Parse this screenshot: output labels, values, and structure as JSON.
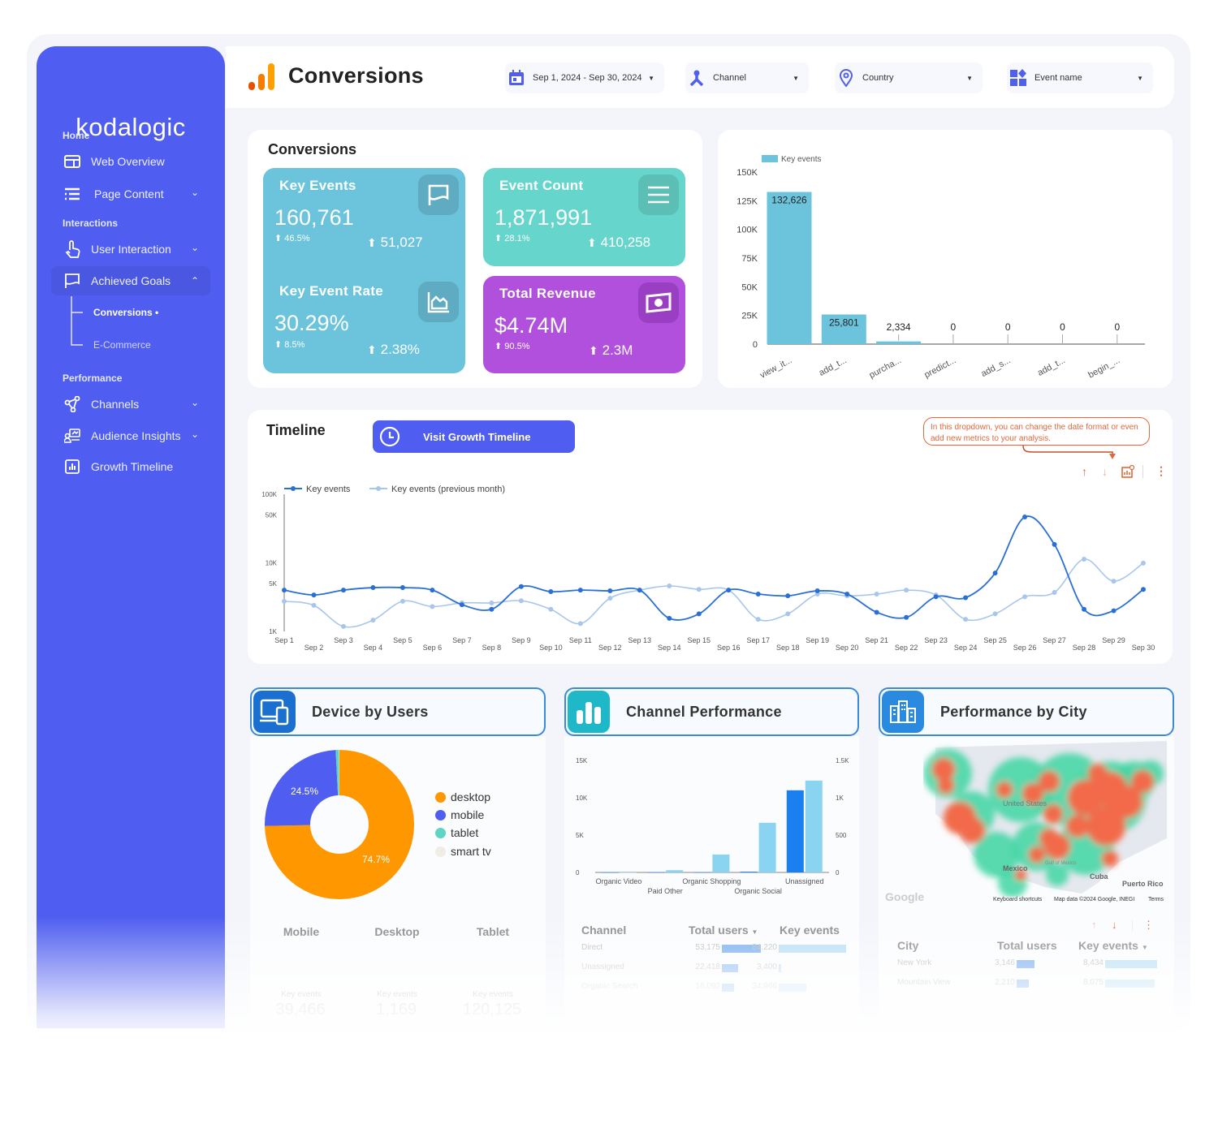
{
  "sidebar": {
    "logo": "kodalogic",
    "sections": [
      {
        "label": "Home"
      },
      {
        "label": "Interactions"
      },
      {
        "label": "Performance"
      }
    ],
    "items": [
      {
        "label": "Web Overview",
        "icon": "layout-icon"
      },
      {
        "label": "Page Content",
        "icon": "list-icon",
        "chevron": "down"
      },
      {
        "label": "User Interaction",
        "icon": "hand-pointer-icon",
        "chevron": "down"
      },
      {
        "label": "Achieved Goals",
        "icon": "flag-icon",
        "chevron": "up",
        "active": true
      },
      {
        "label": "Channels",
        "icon": "share-nodes-icon",
        "chevron": "down"
      },
      {
        "label": "Audience Insights",
        "icon": "presentation-icon",
        "chevron": "down"
      },
      {
        "label": "Growth Timeline",
        "icon": "bar-chart-icon"
      }
    ],
    "subitems": [
      {
        "label": "Conversions •",
        "active": true
      },
      {
        "label": "E-Commerce"
      }
    ]
  },
  "header": {
    "title": "Conversions",
    "filters": [
      {
        "label": "Sep 1, 2024 - Sep 30, 2024",
        "icon": "calendar-icon"
      },
      {
        "label": "Channel",
        "icon": "channel-icon"
      },
      {
        "label": "Country",
        "icon": "location-pin-icon"
      },
      {
        "label": "Event name",
        "icon": "shapes-icon"
      }
    ]
  },
  "conversions": {
    "title": "Conversions",
    "kpis": [
      {
        "title": "Key Events",
        "value": "160,761",
        "pct": "46.5%",
        "delta": "51,027",
        "color": "#6bc4dc",
        "icon": "flag-icon"
      },
      {
        "title": "Event Count",
        "value": "1,871,991",
        "pct": "28.1%",
        "delta": "410,258",
        "color": "#66d6cc",
        "icon": "menu-icon"
      },
      {
        "title": "Key Event Rate",
        "value": "30.29%",
        "pct": "8.5%",
        "delta": "2.38%",
        "color": "#6bc4dc",
        "icon": "area-chart-icon"
      },
      {
        "title": "Total Revenue",
        "value": "$4.74M",
        "pct": "90.5%",
        "delta": "2.3M",
        "color": "#b150dc",
        "icon": "money-icon"
      }
    ]
  },
  "timeline": {
    "title": "Timeline",
    "button": "Visit Growth Timeline",
    "tooltip": "In this dropdown, you can change the date format or even add new metrics to your analysis."
  },
  "device": {
    "title": "Device by Users",
    "columns": [
      "Mobile",
      "Desktop",
      "Tablet"
    ],
    "metric_label": "Key events",
    "metric_values": [
      "39,466",
      "1,169",
      "120,125"
    ]
  },
  "channel": {
    "title": "Channel Performance",
    "headers": [
      "Channel",
      "Total users",
      "Key events"
    ],
    "rows": [
      {
        "name": "Direct",
        "users": "53,175",
        "users_n": 53175,
        "events": "84,220",
        "events_n": 84220
      },
      {
        "name": "Unassigned",
        "users": "22,418",
        "users_n": 22418,
        "events": "3,400",
        "events_n": 3400
      },
      {
        "name": "Organic Search",
        "users": "16,092",
        "users_n": 16092,
        "events": "34,966",
        "events_n": 34966
      }
    ]
  },
  "city": {
    "title": "Performance by City",
    "headers": [
      "City",
      "Total users",
      "Key events"
    ],
    "rows": [
      {
        "name": "New York",
        "users": "3,146",
        "users_n": 3146,
        "events": "8,434",
        "events_n": 8434
      },
      {
        "name": "Mountain View",
        "users": "2,210",
        "users_n": 2210,
        "events": "8,075",
        "events_n": 8075
      }
    ],
    "map": {
      "labels": [
        "United States",
        "Mexico",
        "Cuba",
        "Puerto Rico",
        "Gulf of Mexico"
      ],
      "logo": "Google",
      "shortcuts": "Keyboard shortcuts",
      "attribution": "Map data ©2024 Google, INEGI",
      "terms": "Terms"
    }
  },
  "colors": {
    "sidebar": "#4f5ef0",
    "accent_orange": "#e0683c",
    "line_dark": "#2a6fd6",
    "line_light": "#a8c6ec"
  },
  "chart_data": [
    {
      "type": "bar",
      "legend": "Key events",
      "categories": [
        "view_it...",
        "add_t...",
        "purcha...",
        "predict...",
        "add_s...",
        "add_t...",
        "begin_..."
      ],
      "values": [
        132626,
        25801,
        2334,
        0,
        0,
        0,
        0
      ],
      "data_labels": [
        "132,626",
        "25,801",
        "2,334",
        "0",
        "0",
        "0",
        "0"
      ],
      "ylim": [
        0,
        150000
      ],
      "yticks": [
        "0",
        "25K",
        "50K",
        "75K",
        "100K",
        "125K",
        "150K"
      ],
      "color": "#6bc4dc"
    },
    {
      "type": "line",
      "yscale": "log",
      "ylim": [
        1000,
        100000
      ],
      "yticks": [
        {
          "v": 1000,
          "l": "1K"
        },
        {
          "v": 5000,
          "l": "5K"
        },
        {
          "v": 10000,
          "l": "10K"
        },
        {
          "v": 50000,
          "l": "50K"
        },
        {
          "v": 100000,
          "l": "100K"
        }
      ],
      "x": [
        "Sep 1",
        "Sep 2",
        "Sep 3",
        "Sep 4",
        "Sep 5",
        "Sep 6",
        "Sep 7",
        "Sep 8",
        "Sep 9",
        "Sep 10",
        "Sep 11",
        "Sep 12",
        "Sep 13",
        "Sep 14",
        "Sep 15",
        "Sep 16",
        "Sep 17",
        "Sep 18",
        "Sep 19",
        "Sep 20",
        "Sep 21",
        "Sep 22",
        "Sep 23",
        "Sep 24",
        "Sep 25",
        "Sep 26",
        "Sep 27",
        "Sep 28",
        "Sep 29",
        "Sep 30"
      ],
      "series": [
        {
          "name": "Key events",
          "color": "#2a6fd6",
          "values": [
            4000,
            3400,
            4000,
            4350,
            4350,
            4000,
            2450,
            2100,
            4500,
            3800,
            4000,
            3900,
            4000,
            1550,
            1800,
            4000,
            3500,
            3300,
            3900,
            3500,
            1900,
            1600,
            3200,
            3100,
            7100,
            46600,
            18500,
            2100,
            2000,
            4100
          ]
        },
        {
          "name": "Key events (previous month)",
          "color": "#a8c6ec",
          "values": [
            2750,
            2400,
            1180,
            1460,
            2750,
            2300,
            2600,
            2600,
            2800,
            2100,
            1300,
            3050,
            4000,
            4600,
            4100,
            4000,
            1500,
            1800,
            3500,
            3300,
            3500,
            4000,
            3400,
            1500,
            1800,
            3200,
            3700,
            11300,
            5400,
            9900
          ]
        }
      ]
    },
    {
      "type": "pie",
      "donut": true,
      "categories": [
        "desktop",
        "mobile",
        "tablet",
        "smart tv"
      ],
      "values": [
        74.7,
        24.5,
        0.7,
        0.1
      ],
      "data_labels": [
        "74.7%",
        "24.5%"
      ],
      "colors": [
        "#ff9800",
        "#4f5ef0",
        "#5fd3c4",
        "#f1ece4"
      ]
    },
    {
      "type": "bar",
      "categories": [
        "Organic Video",
        "Paid Other",
        "Organic Shopping",
        "Organic Social",
        "Unassigned"
      ],
      "series": [
        {
          "axis": "left",
          "color": "#1a7ff0",
          "values": [
            0,
            0,
            10,
            100,
            11000
          ]
        },
        {
          "axis": "right",
          "color": "#8ad4f2",
          "values": [
            0,
            30,
            240,
            665,
            1230
          ]
        }
      ],
      "ylim_left": [
        0,
        15000
      ],
      "yticks_left": [
        "0",
        "5K",
        "10K",
        "15K"
      ],
      "ylim_right": [
        0,
        1500
      ],
      "yticks_right": [
        "0",
        "500",
        "1K",
        "1.5K"
      ]
    }
  ]
}
